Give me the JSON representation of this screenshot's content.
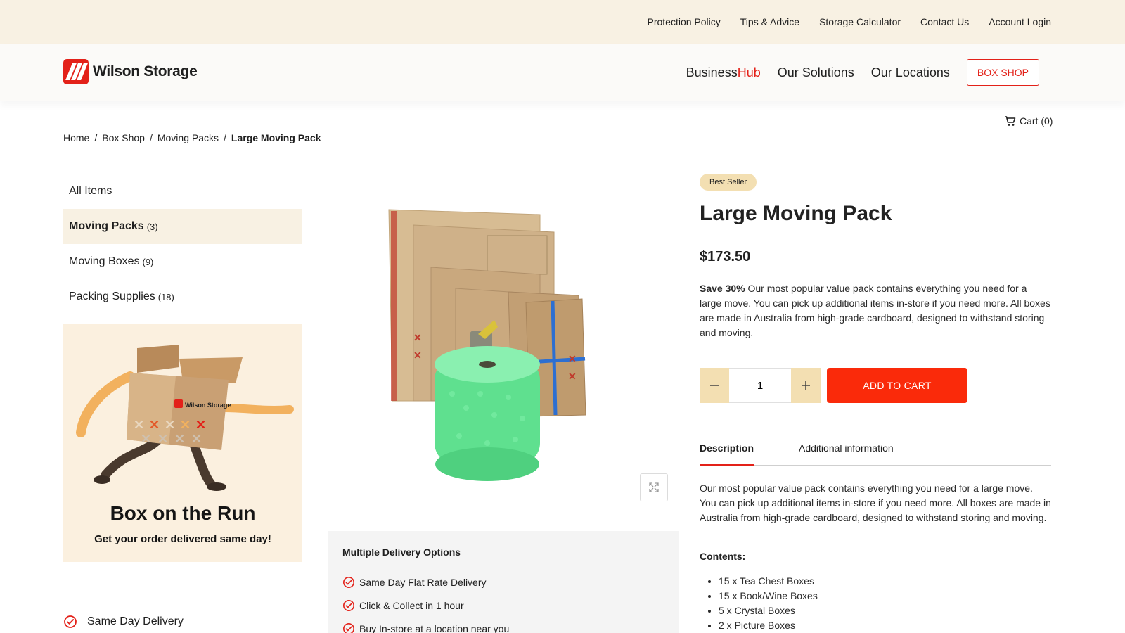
{
  "topbar": {
    "links": [
      "Protection Policy",
      "Tips & Advice",
      "Storage Calculator",
      "Contact Us",
      "Account Login"
    ]
  },
  "header": {
    "logo_text": "Wilson Storage",
    "nav": {
      "business_prefix": "Business",
      "business_suffix": "Hub",
      "solutions": "Our Solutions",
      "locations": "Our Locations",
      "box_shop": "BOX SHOP"
    }
  },
  "cart": {
    "label": "Cart (0)"
  },
  "breadcrumb": {
    "items": [
      "Home",
      "Box Shop",
      "Moving Packs"
    ],
    "current": "Large Moving Pack",
    "separator": "/"
  },
  "sidebar": {
    "categories": [
      {
        "label": "All Items",
        "count": ""
      },
      {
        "label": "Moving Packs",
        "count": "(3)"
      },
      {
        "label": "Moving Boxes",
        "count": "(9)"
      },
      {
        "label": "Packing Supplies",
        "count": "(18)"
      }
    ],
    "promo": {
      "logo_text": "Wilson Storage",
      "title": "Box on the Run",
      "subtitle": "Get your order delivered same day!"
    },
    "feature": "Same Day Delivery"
  },
  "delivery": {
    "title": "Multiple Delivery Options",
    "options": [
      "Same Day Flat Rate Delivery",
      "Click & Collect in 1 hour",
      "Buy In-store at a location near you"
    ]
  },
  "product": {
    "badge": "Best Seller",
    "title": "Large Moving Pack",
    "price": "$173.50",
    "save": "Save 30%",
    "summary": " Our most popular value pack contains everything you need for a large move. You can pick up additional items in-store if you need more. All boxes are made in Australia from high-grade cardboard, designed to withstand storing and moving.",
    "quantity": "1",
    "add_to_cart": "ADD TO CART"
  },
  "tabs": [
    "Description",
    "Additional information"
  ],
  "description": {
    "text": "Our most popular value pack contains everything you need for a large move. You can pick up additional items in-store if you need more. All boxes are made in Australia from high-grade cardboard, designed to withstand storing and moving.",
    "contents_label": "Contents:",
    "contents": [
      "15 x Tea Chest Boxes",
      "15 x Book/Wine Boxes",
      "5 x Crystal Boxes",
      "2 x Picture Boxes"
    ]
  },
  "colors": {
    "brand_red": "#e32119",
    "cta_red": "#fa2a0a",
    "cream": "#f8f1e3",
    "badge": "#f3dfb2"
  },
  "icons": [
    "cart-icon",
    "check-circle-icon",
    "minus-icon",
    "plus-icon",
    "expand-icon"
  ]
}
